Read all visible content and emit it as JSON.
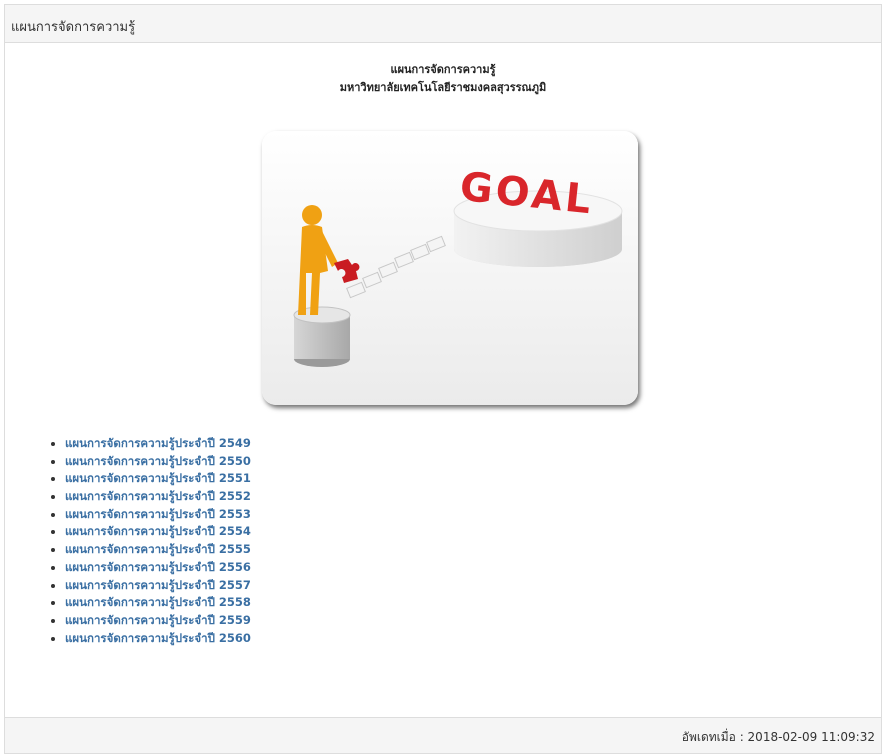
{
  "panel": {
    "heading": "แผนการจัดการความรู้"
  },
  "document": {
    "title_line1": "แผนการจัดการความรู้",
    "title_line2": "มหาวิทยาลัยเทคโนโลยีราชมงคลสุวรรณภูมิ"
  },
  "image": {
    "goal_text": "GOAL",
    "colors": {
      "goal_red": "#d9262b",
      "figure_orange": "#f0a113",
      "puzzle_red": "#c91c22"
    }
  },
  "links": [
    {
      "label": "แผนการจัดการความรู้ประจำปี 2549"
    },
    {
      "label": "แผนการจัดการความรู้ประจำปี 2550"
    },
    {
      "label": "แผนการจัดการความรู้ประจำปี 2551"
    },
    {
      "label": "แผนการจัดการความรู้ประจำปี 2552"
    },
    {
      "label": "แผนการจัดการความรู้ประจำปี 2553"
    },
    {
      "label": "แผนการจัดการความรู้ประจำปี 2554"
    },
    {
      "label": "แผนการจัดการความรู้ประจำปี 2555"
    },
    {
      "label": "แผนการจัดการความรู้ประจำปี 2556"
    },
    {
      "label": "แผนการจัดการความรู้ประจำปี 2557"
    },
    {
      "label": "แผนการจัดการความรู้ประจำปี 2558"
    },
    {
      "label": "แผนการจัดการความรู้ประจำปี 2559"
    },
    {
      "label": "แผนการจัดการความรู้ประจำปี 2560"
    }
  ],
  "footer": {
    "updated_text": "อัพเดทเมื่อ : 2018-02-09 11:09:32"
  }
}
